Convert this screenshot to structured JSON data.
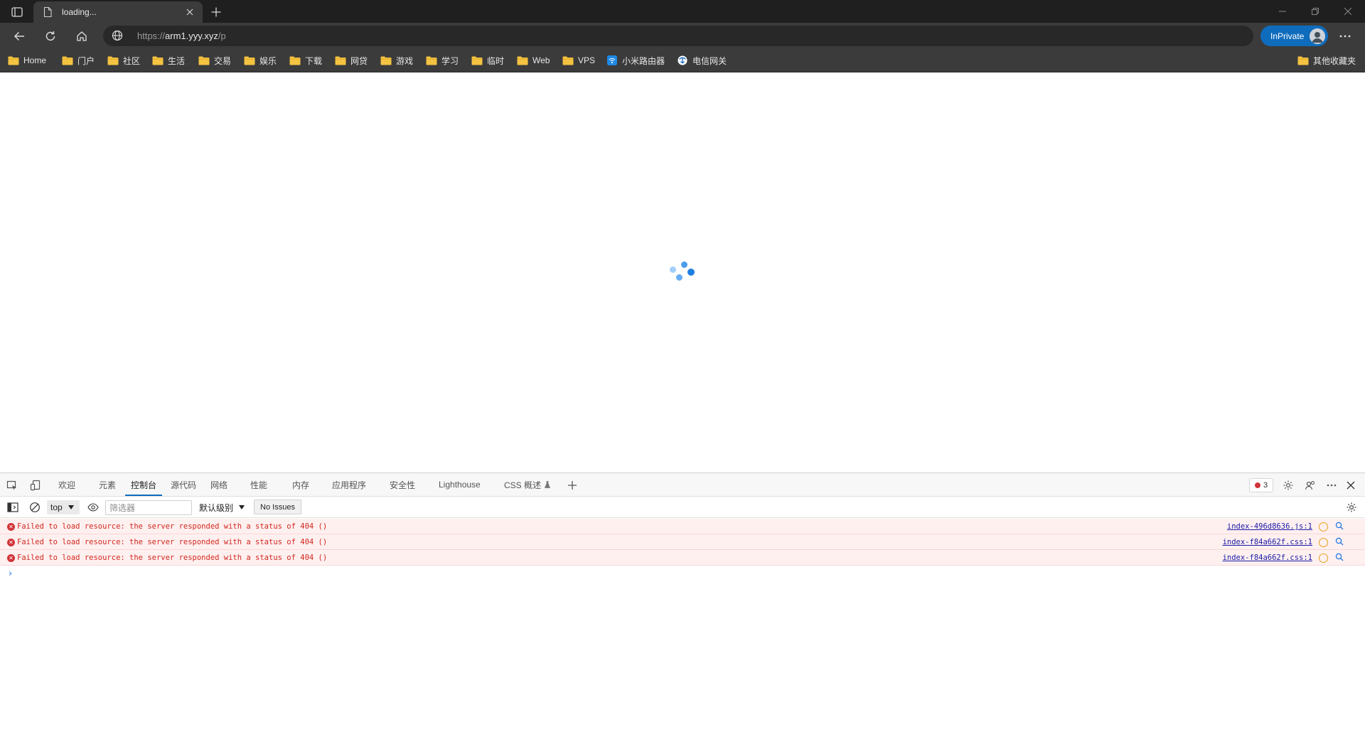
{
  "browser": {
    "tab": {
      "title": "loading..."
    },
    "address": {
      "scheme": "https://",
      "host": "arm1.yyy.xyz",
      "path": "/p"
    },
    "inprivate_label": "InPrivate",
    "favorites": [
      {
        "label": "Home",
        "icon": "folder-icon"
      },
      {
        "label": "门户",
        "icon": "folder-icon"
      },
      {
        "label": "社区",
        "icon": "folder-icon"
      },
      {
        "label": "生活",
        "icon": "folder-icon"
      },
      {
        "label": "交易",
        "icon": "folder-icon"
      },
      {
        "label": "娱乐",
        "icon": "folder-icon"
      },
      {
        "label": "下载",
        "icon": "folder-icon"
      },
      {
        "label": "网贷",
        "icon": "folder-icon"
      },
      {
        "label": "游戏",
        "icon": "folder-icon"
      },
      {
        "label": "学习",
        "icon": "folder-icon"
      },
      {
        "label": "临时",
        "icon": "folder-icon"
      },
      {
        "label": "Web",
        "icon": "folder-icon"
      },
      {
        "label": "VPS",
        "icon": "folder-icon"
      },
      {
        "label": "小米路由器",
        "icon": "wifi-router-icon"
      },
      {
        "label": "电信网关",
        "icon": "telecom-logo-icon"
      }
    ],
    "other_favorites": "其他收藏夹"
  },
  "page": {
    "state": "loading",
    "spinner_color": "#2b8ce6"
  },
  "devtools": {
    "tabs": [
      "欢迎",
      "元素",
      "控制台",
      "源代码",
      "网络",
      "性能",
      "内存",
      "应用程序",
      "安全性",
      "Lighthouse",
      "CSS 概述"
    ],
    "active_tab": "控制台",
    "error_count": "3",
    "console": {
      "context": "top",
      "filter_placeholder": "筛选器",
      "level": "默认级别",
      "issues": "No Issues",
      "messages": [
        {
          "level": "error",
          "text": "Failed to load resource: the server responded with a status of 404 ()",
          "source": "index-496d8636.js:1"
        },
        {
          "level": "error",
          "text": "Failed to load resource: the server responded with a status of 404 ()",
          "source": "index-f84a662f.css:1"
        },
        {
          "level": "error",
          "text": "Failed to load resource: the server responded with a status of 404 ()",
          "source": "index-f84a662f.css:1"
        }
      ],
      "prompt": "›"
    }
  },
  "colors": {
    "accent": "#0f6cbd",
    "error": "#d13438",
    "folder": "#f5c342"
  }
}
